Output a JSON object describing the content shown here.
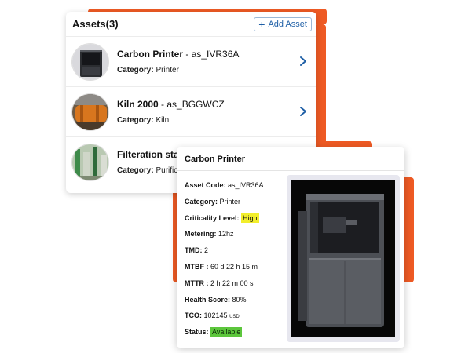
{
  "assets_panel": {
    "title": "Assets(3)",
    "add_button": "Add Asset",
    "items": [
      {
        "name": "Carbon Printer",
        "code": " - as_IVR36A",
        "category_label": "Category: ",
        "category": "Printer"
      },
      {
        "name": "Kiln 2000",
        "code": " - as_BGGWCZ",
        "category_label": "Category: ",
        "category": "Kiln"
      },
      {
        "name": "Filteration sta",
        "code": "",
        "category_label": "Category: ",
        "category": "Purific"
      }
    ]
  },
  "detail": {
    "title": "Carbon Printer",
    "fields": [
      {
        "label": "Asset Code: ",
        "value": "as_IVR36A"
      },
      {
        "label": "Category: ",
        "value": "Printer"
      },
      {
        "label": "Criticality Level: ",
        "value": "High"
      },
      {
        "label": "Metering: ",
        "value": "12hz"
      },
      {
        "label": "TMD: ",
        "value": "2"
      },
      {
        "label": "MTBF : ",
        "value": "60 d 22 h 15 m"
      },
      {
        "label": "MTTR : ",
        "value": "2 h 22 m 00 s"
      },
      {
        "label": "Health Score: ",
        "value": "80%"
      },
      {
        "label": "TCO: ",
        "value": "102145",
        "unit": "USD"
      },
      {
        "label": "Status: ",
        "value": "Available"
      }
    ]
  },
  "colors": {
    "accent_orange": "#ee5a24",
    "link_blue": "#1f5fa6",
    "criticality_high": "#f2ee2c",
    "status_available": "#5cc63c"
  }
}
